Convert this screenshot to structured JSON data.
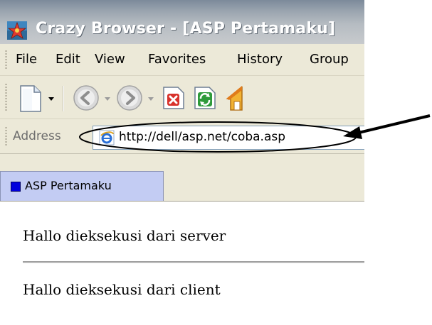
{
  "window": {
    "title": "Crazy Browser - [ASP Pertamaku]"
  },
  "menu": {
    "items": [
      "File",
      "Edit",
      "View",
      "Favorites",
      "History",
      "Group"
    ]
  },
  "toolbar": {
    "buttons": [
      "new-page-icon",
      "back-icon",
      "forward-icon",
      "stop-icon",
      "refresh-icon",
      "home-icon"
    ]
  },
  "address": {
    "label": "Address",
    "url": "http://dell/asp.net/coba.asp"
  },
  "tabs": [
    {
      "label": "ASP Pertamaku"
    }
  ],
  "content": {
    "server_line": "Hallo dieksekusi dari server",
    "client_line": "Hallo dieksekusi dari client"
  },
  "colors": {
    "tab_active": "#c3ccf3",
    "tab_marker": "#0000dd",
    "chrome": "#ece9d8"
  }
}
